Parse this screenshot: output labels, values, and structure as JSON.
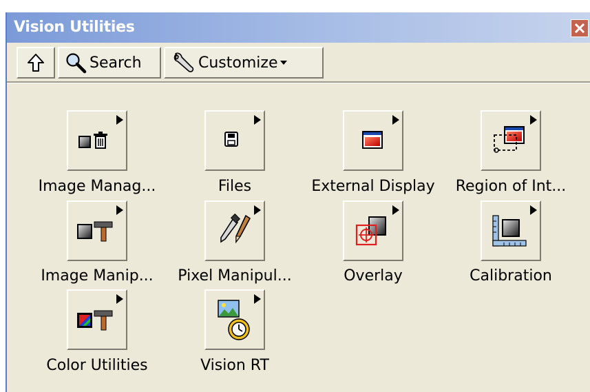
{
  "window": {
    "title": "Vision Utilities",
    "close_symbol": "✕"
  },
  "toolbar": {
    "up_icon": "up-arrow-icon",
    "search_label": "Search",
    "customize_label": "Customize"
  },
  "palette": {
    "items": [
      {
        "label": "Image Manag...",
        "icon": "image-management-icon"
      },
      {
        "label": "Files",
        "icon": "floppy-disk-icon"
      },
      {
        "label": "External Display",
        "icon": "window-display-icon"
      },
      {
        "label": "Region of Int...",
        "icon": "region-of-interest-icon"
      },
      {
        "label": "Image Manip...",
        "icon": "image-manipulation-icon"
      },
      {
        "label": "Pixel Manipul...",
        "icon": "pixel-manipulation-icon"
      },
      {
        "label": "Overlay",
        "icon": "overlay-icon"
      },
      {
        "label": "Calibration",
        "icon": "calibration-icon"
      },
      {
        "label": "Color Utilities",
        "icon": "color-utilities-icon"
      },
      {
        "label": "Vision RT",
        "icon": "vision-rt-icon"
      }
    ]
  },
  "colors": {
    "panel_bg": "#ece9d8",
    "titlebar_start": "#7b9ad8",
    "close_red": "#c2624f",
    "accent_red": "#e02020"
  }
}
